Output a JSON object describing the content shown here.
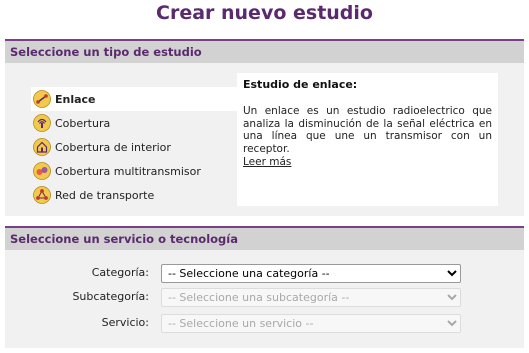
{
  "page_title": "Crear nuevo estudio",
  "section1": {
    "header": "Seleccione un tipo de estudio",
    "types": [
      {
        "label": "Enlace",
        "icon": "link-icon",
        "active": true
      },
      {
        "label": "Cobertura",
        "icon": "coverage-icon"
      },
      {
        "label": "Cobertura de interior",
        "icon": "indoor-coverage-icon"
      },
      {
        "label": "Cobertura multitransmisor",
        "icon": "multi-transmitter-icon"
      },
      {
        "label": "Red de transporte",
        "icon": "transport-network-icon"
      }
    ],
    "description": {
      "title": "Estudio de enlace:",
      "text": "Un enlace es un estudio radioelectrico que analiza la disminución de la señal eléctrica en una línea que une un transmisor con un receptor.",
      "link": "Leer más"
    }
  },
  "section2": {
    "header": "Seleccione un servicio o tecnología",
    "fields": {
      "categoria": {
        "label": "Categoría:",
        "value": "-- Seleccione una categoría --"
      },
      "subcategoria": {
        "label": "Subcategoría:",
        "value": "-- Seleccione una subcategoría --"
      },
      "servicio": {
        "label": "Servicio:",
        "value": "-- Seleccione un servicio --"
      }
    }
  },
  "colors": {
    "accent": "#5b2a6e",
    "header_bg": "#d2d2d2",
    "icon_yellow": "#f2c94c"
  }
}
